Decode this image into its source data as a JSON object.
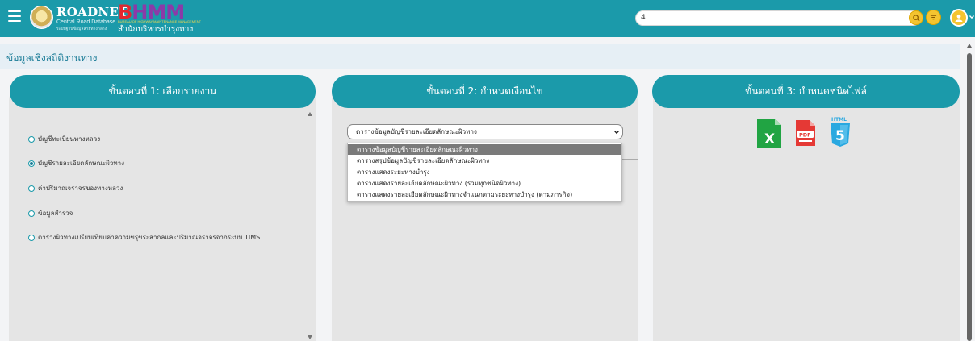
{
  "header": {
    "brand": "ROADNET",
    "brand_sub1": "Central Road Database",
    "brand_sub2": "ระบบฐานข้อมูลสายทางกลาง",
    "bhmm_b": "B",
    "bhmm_h": "H",
    "bhmm_mm": "MM",
    "bhmm_tiny": "BUREAU OF HIGHWAY MAINTENANCE MANAGEMENT",
    "bhmm_thai": "สำนักบริหารบำรุงทาง",
    "search_value": "4"
  },
  "page": {
    "title": "ข้อมูลเชิงสถิติงานทาง"
  },
  "step1": {
    "title": "ขั้นตอนที่ 1: เลือกรายงาน",
    "options": [
      {
        "label": "บัญชีทะเบียนทางหลวง",
        "checked": false
      },
      {
        "label": "บัญชีรายละเอียดลักษณะผิวทาง",
        "checked": true
      },
      {
        "label": "ค่าปริมาณจราจรของทางหลวง",
        "checked": false
      },
      {
        "label": "ข้อมูลสำรวจ",
        "checked": false
      },
      {
        "label": "ตารางผิวทางเปรียบเทียบค่าความขรุขระสากลและปริมาณจราจรจากระบบ TIMS",
        "checked": false
      }
    ]
  },
  "step2": {
    "title": "ขั้นตอนที่ 2: กำหนดเงื่อนไข",
    "selected": "ตารางข้อมูลบัญชีรายละเอียดลักษณะผิวทาง",
    "options": [
      "ตารางข้อมูลบัญชีรายละเอียดลักษณะผิวทาง",
      "ตารางสรุปข้อมูลบัญชีรายละเอียดลักษณะผิวทาง",
      "ตารางแสดงระยะทางบำรุง",
      "ตารางแสดงรายละเอียดลักษณะผิวทาง (รวมทุกชนิดผิวทาง)",
      "ตารางแสดงรายละเอียดลักษณะผิวทางจำแนกตามระยะทางบำรุง (ตามภารกิจ)"
    ]
  },
  "step3": {
    "title": "ขั้นตอนที่ 3: กำหนดชนิดไฟล์",
    "excel_letter": "X",
    "pdf_text": "PDF",
    "html_text": "HTML",
    "html_num": "5"
  },
  "colors": {
    "primary": "#1b9aaa",
    "panel_bg": "#e5e5e5",
    "accent_yellow": "#f4c430",
    "excel_green": "#21a443",
    "pdf_red": "#e53935",
    "html_blue": "#29a8e0"
  }
}
